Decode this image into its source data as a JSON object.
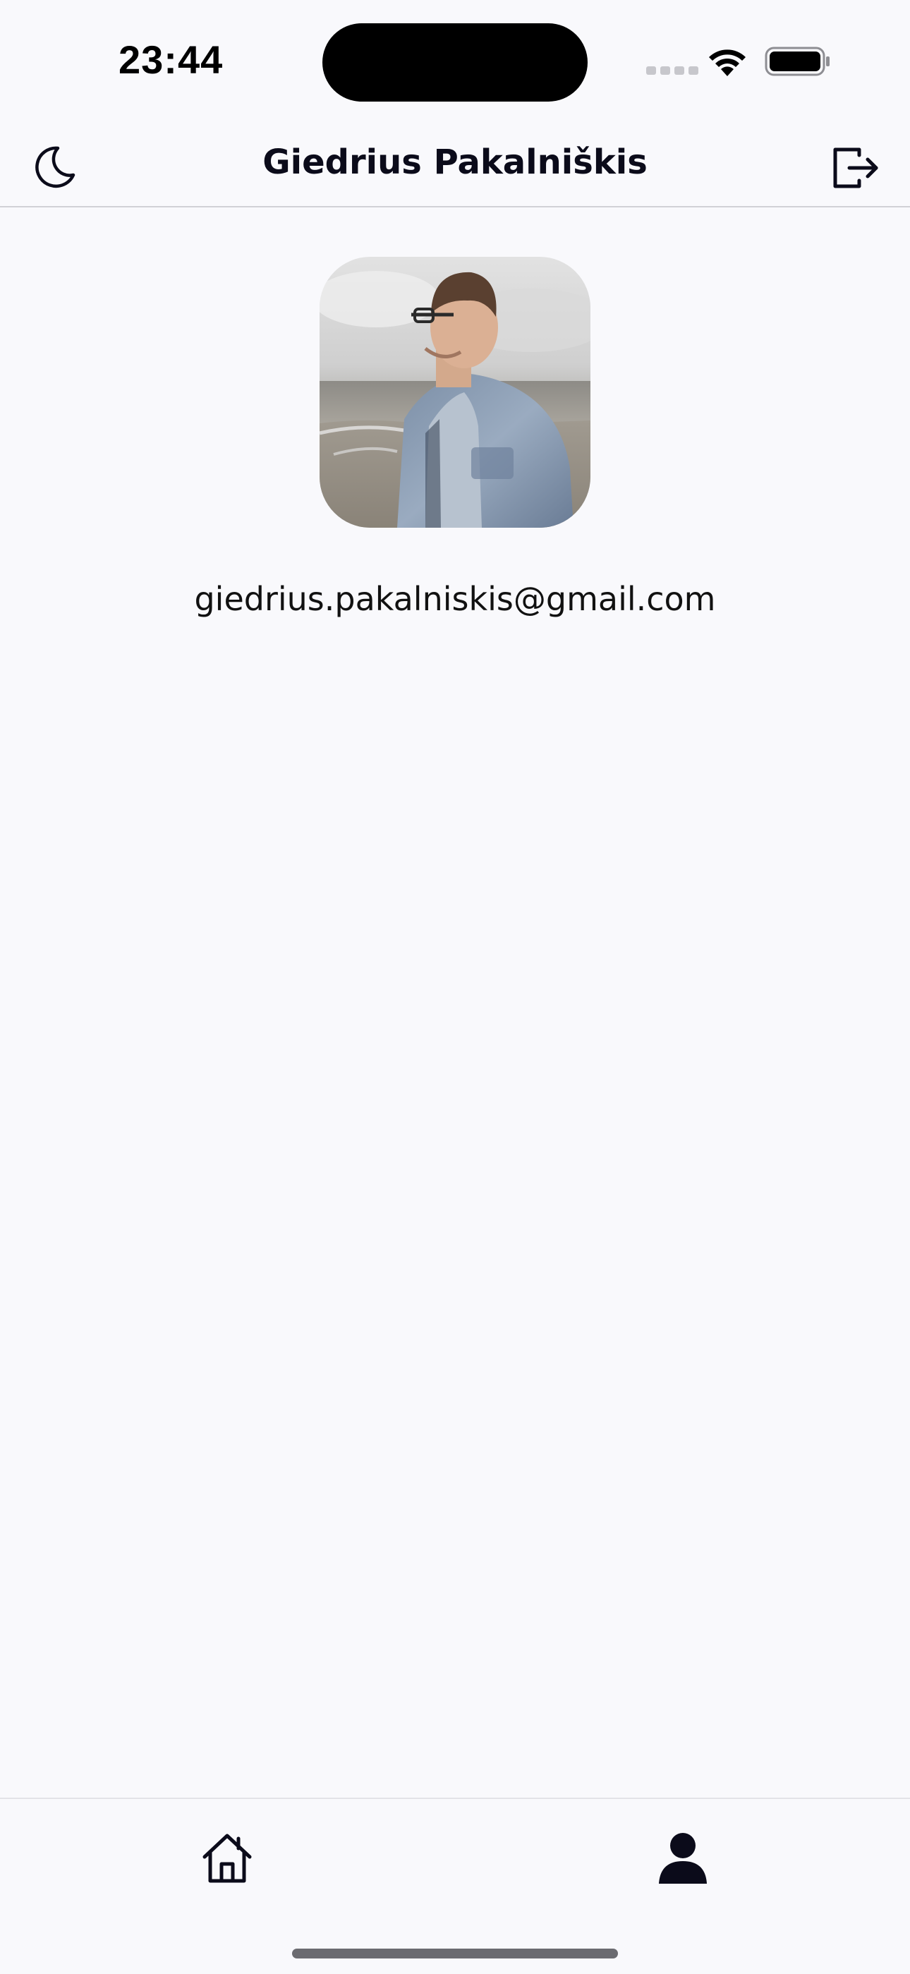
{
  "status_bar": {
    "time": "23:44"
  },
  "header": {
    "title": "Giedrius Pakalniškis",
    "left_icon": "moon-icon",
    "right_icon": "logout-icon"
  },
  "profile": {
    "email": "giedrius.pakalniskis@gmail.com"
  },
  "tab_bar": {
    "items": [
      {
        "icon": "home-icon",
        "selected": false
      },
      {
        "icon": "person-icon",
        "selected": true
      }
    ]
  },
  "colors": {
    "background": "#f9f9fc",
    "text": "#0b0b1a",
    "divider": "#d1d1d6"
  }
}
